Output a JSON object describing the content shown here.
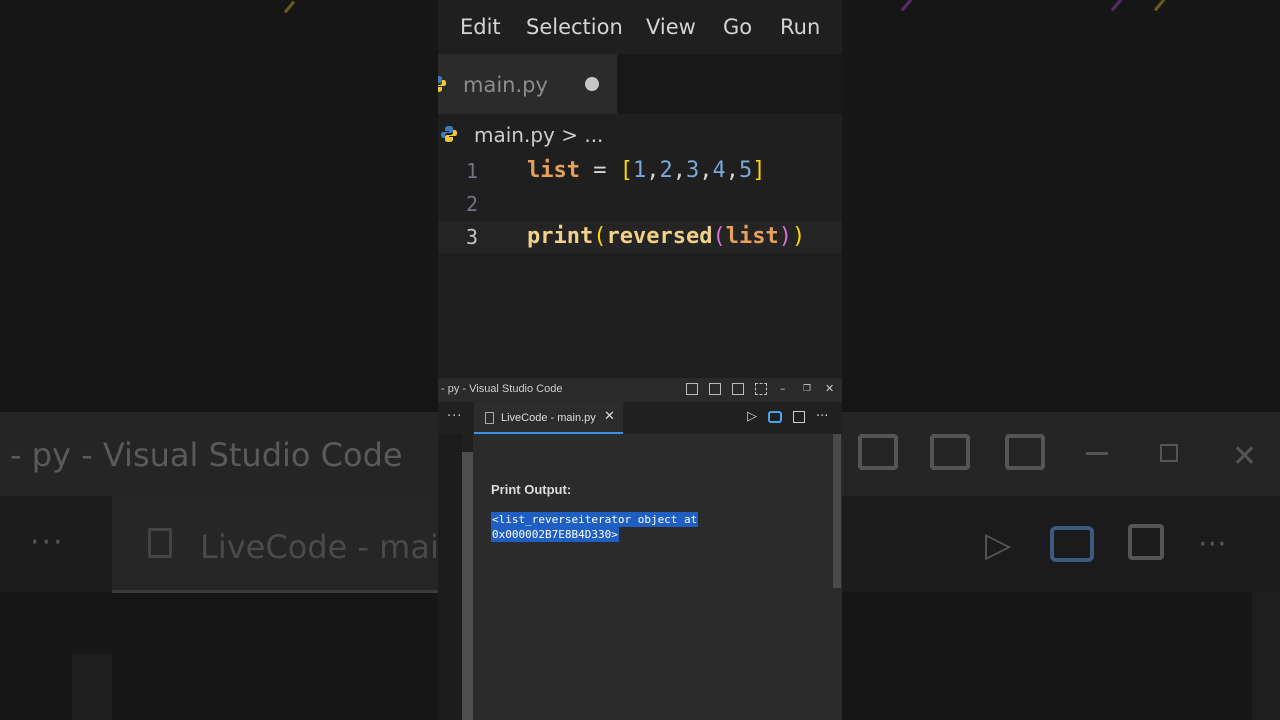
{
  "background": {
    "window_title": "- py - Visual Studio Code",
    "tab_label": "LiveCode - mai"
  },
  "menu": {
    "items": [
      "Edit",
      "Selection",
      "View",
      "Go",
      "Run"
    ]
  },
  "editor_tab": {
    "filename": "main.py",
    "icon": "python-icon",
    "unsaved_indicator": "dot"
  },
  "breadcrumb": {
    "text": "main.py > ..."
  },
  "code": {
    "line_numbers": [
      "1",
      "2",
      "3"
    ],
    "current_line": 3,
    "lines": [
      "list = [1,2,3,4,5]",
      "",
      "print(reversed(list))"
    ]
  },
  "small_window": {
    "title": "- py - Visual Studio Code"
  },
  "panel": {
    "more_label": "···",
    "tab_label": "LiveCode - main.py",
    "close_glyph": "✕",
    "print_output_label": "Print Output:",
    "output_lines": [
      "<list_reverseiterator object at",
      "0x000002B7E8B4D330>"
    ]
  },
  "colors": {
    "accent": "#3b8eea",
    "selection": "#1f5fc4",
    "variable": "#e5a15b",
    "number": "#7aa8d8",
    "function": "#f1d18a",
    "bracket_outer": "#ffd700",
    "bracket_inner": "#da70d6"
  }
}
